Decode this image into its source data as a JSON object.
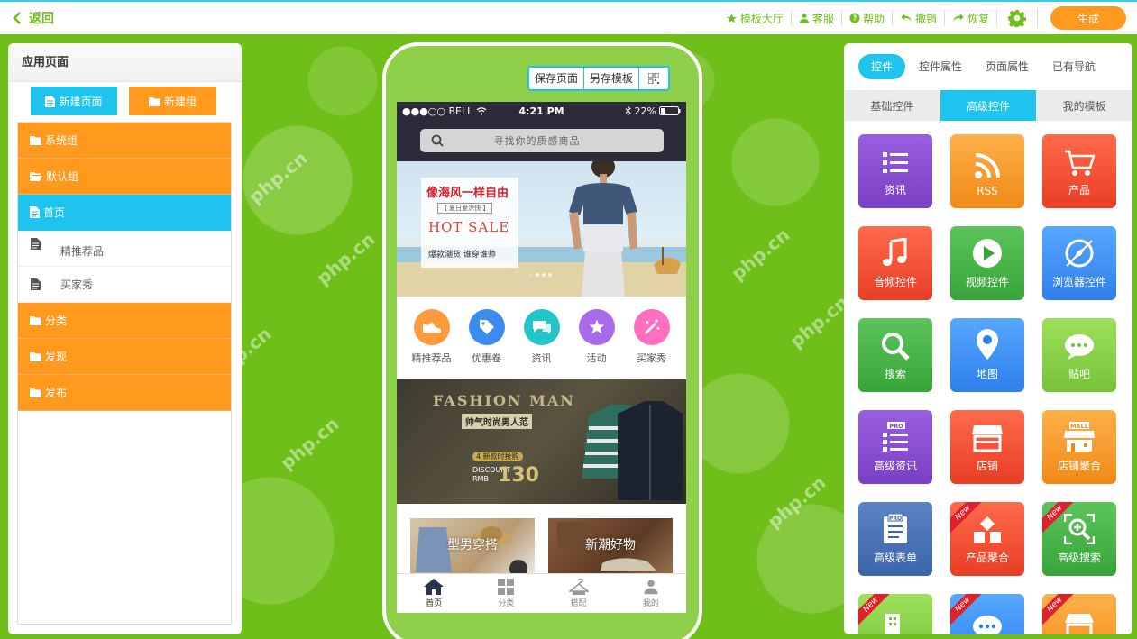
{
  "topbar": {
    "back_label": "返回",
    "tools": [
      {
        "icon": "star-icon",
        "label": "模板大厅"
      },
      {
        "icon": "user-icon",
        "label": "客服"
      },
      {
        "icon": "help-icon",
        "label": "帮助"
      },
      {
        "icon": "undo-icon",
        "label": "撤销"
      },
      {
        "icon": "redo-icon",
        "label": "恢复"
      }
    ],
    "generate_label": "生成"
  },
  "left": {
    "title": "应用页面",
    "new_page": "新建页面",
    "new_group": "新建组",
    "items": [
      {
        "label": "系统组",
        "type": "group"
      },
      {
        "label": "默认组",
        "type": "group-open"
      },
      {
        "label": "首页",
        "type": "page-selected"
      },
      {
        "label": "精推荐品",
        "type": "page"
      },
      {
        "label": "买家秀",
        "type": "page"
      },
      {
        "label": "分类",
        "type": "group"
      },
      {
        "label": "发现",
        "type": "group"
      },
      {
        "label": "发布",
        "type": "group"
      }
    ]
  },
  "phone_tools": {
    "save": "保存页面",
    "save_as": "另存模板"
  },
  "phone": {
    "carrier": "●●●○○ BELL",
    "time": "4:21 PM",
    "battery": "22%",
    "search_placeholder": "寻找你的质感商品",
    "banner": {
      "line1": "像海风一样自由",
      "line2": "【 夏日爱凉快 】",
      "line3": "HOT SALE",
      "line4": "爆款潮货  谁穿谁帅"
    },
    "icons": [
      {
        "label": "精推荐品",
        "color": "#ff9a3c"
      },
      {
        "label": "优惠卷",
        "color": "#3c8cf0"
      },
      {
        "label": "资讯",
        "color": "#22c5c8"
      },
      {
        "label": "活动",
        "color": "#a86ae8"
      },
      {
        "label": "买家秀",
        "color": "#ff6ec0"
      }
    ],
    "fashion": {
      "title": "FASHION MAN",
      "sub": "帅气时尚男人范",
      "tag": "4 新款时抢购",
      "discount": "DISCOUNT",
      "rmb": "RMB",
      "price": "130"
    },
    "cards": [
      "型男穿搭",
      "新潮好物"
    ],
    "tabs": [
      "首页",
      "分类",
      "搭配",
      "我的"
    ]
  },
  "right": {
    "tabs": [
      "控件",
      "控件属性",
      "页面属性",
      "已有导航"
    ],
    "subtabs": [
      "基础控件",
      "高级控件",
      "我的模板"
    ],
    "widgets": [
      {
        "label": "资讯",
        "icon": "list-icon",
        "color": "purple"
      },
      {
        "label": "RSS",
        "icon": "rss-icon",
        "color": "org"
      },
      {
        "label": "产品",
        "icon": "cart-icon",
        "color": "red"
      },
      {
        "label": "音频控件",
        "icon": "music-icon",
        "color": "red"
      },
      {
        "label": "视频控件",
        "icon": "play-icon",
        "color": "grn"
      },
      {
        "label": "浏览器控件",
        "icon": "compass-icon",
        "color": "blu"
      },
      {
        "label": "搜索",
        "icon": "search-icon",
        "color": "grn"
      },
      {
        "label": "地图",
        "icon": "map-pin-icon",
        "color": "blu"
      },
      {
        "label": "贴吧",
        "icon": "chat-icon",
        "color": "lgr"
      },
      {
        "label": "高级资讯",
        "icon": "pro-list-icon",
        "color": "purple",
        "badge": "PRO"
      },
      {
        "label": "店铺",
        "icon": "store-icon",
        "color": "red"
      },
      {
        "label": "店铺聚合",
        "icon": "mall-icon",
        "color": "org",
        "badge": "MALL"
      },
      {
        "label": "高级表单",
        "icon": "pro-form-icon",
        "color": "sblu",
        "badge": "PRO"
      },
      {
        "label": "产品聚合",
        "icon": "blocks-icon",
        "color": "red",
        "new": "New"
      },
      {
        "label": "高级搜索",
        "icon": "zoom-plus-icon",
        "color": "grn",
        "new": "New"
      },
      {
        "label": "",
        "icon": "building-icon",
        "color": "lgr",
        "new": "New"
      },
      {
        "label": "",
        "icon": "bubble-icon",
        "color": "blu",
        "new": "New"
      },
      {
        "label": "",
        "icon": "shop-icon",
        "color": "org",
        "new": "New"
      }
    ]
  },
  "watermark": "php.cn"
}
